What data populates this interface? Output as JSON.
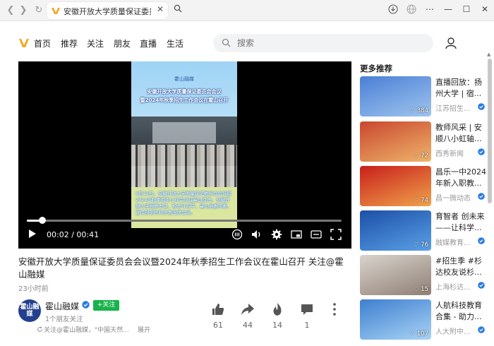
{
  "browser": {
    "tab_title": "安徽开放大学质量保证委员会",
    "close_glyph": "✕"
  },
  "nav": {
    "items": [
      "首页",
      "推荐",
      "关注",
      "朋友",
      "直播",
      "生活"
    ],
    "search_placeholder": "搜索",
    "brand_color": "#f5a623"
  },
  "player": {
    "frame_heading": "霍山融媒",
    "headline_1": "安徽开放大学质量保证委员会会议",
    "headline_2": "暨2024年秋季招生工作会议在霍山召开",
    "caption": "8月22日，安徽开放大学质量保证委员会会议暨2024年秋季招生工作会议在霍山召开。安徽开放大学党委书记、校长叶宏平，霍山县委常委、宣传部部长韩长青出席会议。",
    "time_current": "00:02",
    "time_total": "00:41",
    "progress": 0.05
  },
  "video": {
    "title": "安徽开放大学质量保证委员会会议暨2024年秋季招生工作会议在霍山召开 关注@霍山融媒",
    "posted": "23小时前",
    "author": "霍山融媒",
    "avatar_text": "霍山融媒",
    "follow_label": "+关注",
    "fans": "1个朋友关注",
    "desc": "关注@霍山融媒，\"中国天然...",
    "expand": "展开",
    "actions": [
      {
        "icon": "thumbs-up-icon",
        "count": "61"
      },
      {
        "icon": "share-icon",
        "count": "44"
      },
      {
        "icon": "flame-icon",
        "count": "14"
      },
      {
        "icon": "comment-icon",
        "count": "1"
      }
    ]
  },
  "recommend": {
    "heading": "更多推荐",
    "items": [
      {
        "title": "直播回放：扬州大学 | 宿...",
        "source": "江苏招生...",
        "count": "384",
        "colors": [
          "#4a7fd6",
          "#9fc5ee"
        ]
      },
      {
        "title": "教师风采 | 安顺八小虹轴...",
        "source": "西秀新闻",
        "count": "72",
        "colors": [
          "#c9472f",
          "#efb46a"
        ]
      },
      {
        "title": "昌乐一中2024年新入职教...",
        "source": "昌一微动态",
        "count": "74",
        "colors": [
          "#c81f1b",
          "#f0a24b"
        ]
      },
      {
        "title": "育智者 创未来——让科学...",
        "source": "融媒教育...",
        "count": "76",
        "colors": [
          "#1c4fa8",
          "#5aa0e6"
        ]
      },
      {
        "title": "#招生季 #杉达校友说杉...",
        "source": "上海杉达...",
        "count": "15",
        "colors": [
          "#d9d4ce",
          "#8f7f74"
        ]
      },
      {
        "title": "人航科技教育合集 - 助力...",
        "source": "人大附中...",
        "count": "107",
        "colors": [
          "#3d7fd0",
          "#a9d3f5"
        ]
      }
    ]
  }
}
